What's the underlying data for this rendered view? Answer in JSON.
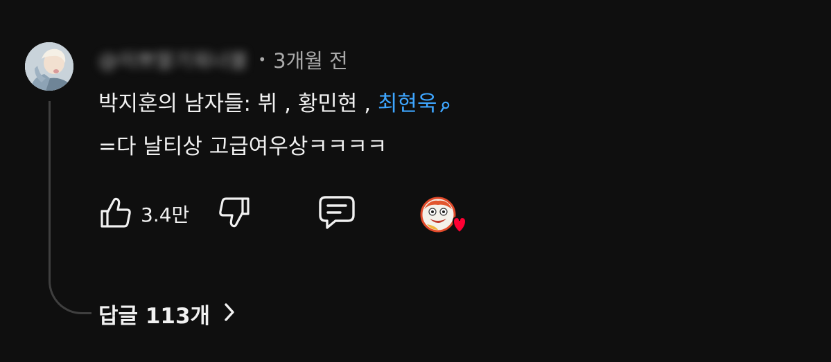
{
  "comment": {
    "username": "@이쁘딸기워너블",
    "separator": "•",
    "timestamp": "3개월 전",
    "text_line1_prefix": "박지훈의 남자들: 뷔 , 황민현 , ",
    "mention": "최현욱",
    "text_line2": "=다 날티상 고급여우상ㅋㅋㅋㅋ"
  },
  "actions": {
    "like_count": "3.4만"
  },
  "replies": {
    "label": "답글 113개"
  },
  "colors": {
    "background": "#0f0f0f",
    "text": "#f1f1f1",
    "secondary_text": "#aaaaaa",
    "mention": "#3ea6ff",
    "heart": "#ff0033",
    "thread_line": "#3f3f3f"
  },
  "icons": {
    "like": "thumbs-up-icon",
    "dislike": "thumbs-down-icon",
    "reply": "comment-reply-icon",
    "mention_search": "search-icon",
    "creator_heart": "creator-heart-icon",
    "chevron": "chevron-right-icon"
  }
}
